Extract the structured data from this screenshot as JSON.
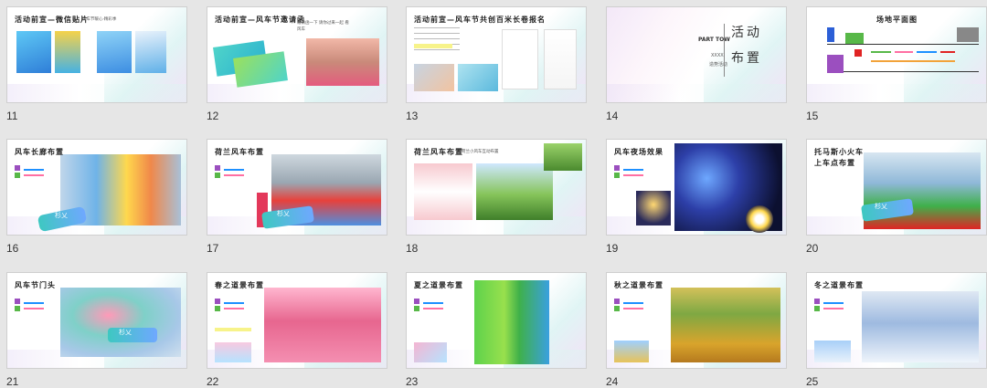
{
  "slides": [
    {
      "num": "11",
      "title": "活动前宣—微信贴片",
      "note": "风车节暖心·精彩季"
    },
    {
      "num": "12",
      "title": "活动前宣—风车节邀请函",
      "note": "邀请函一下 请你过来一起 看风车"
    },
    {
      "num": "13",
      "title": "活动前宣—风车节共创百米长卷报名",
      "note": "报名现场"
    },
    {
      "num": "14",
      "part": "PART TOW",
      "big1": "活动",
      "big2": "布置",
      "small": "XXXX",
      "sub": "造势活动"
    },
    {
      "num": "15",
      "title": "场地平面图"
    },
    {
      "num": "16",
      "title": "风车长廊布置",
      "banner": "杉乂"
    },
    {
      "num": "17",
      "title": "荷兰风车布置",
      "banner": "杉乂"
    },
    {
      "num": "18",
      "title": "荷兰风车布置",
      "note": "荷兰小风车互动布置"
    },
    {
      "num": "19",
      "title": "风车夜场效果"
    },
    {
      "num": "20",
      "title": "托马斯小火车",
      "title2": "上车点布置",
      "banner": "杉乂"
    },
    {
      "num": "21",
      "title": "风车节门头",
      "banner": "杉乂"
    },
    {
      "num": "22",
      "title": "春之道景布置"
    },
    {
      "num": "23",
      "title": "夏之道景布置"
    },
    {
      "num": "24",
      "title": "秋之道景布置"
    },
    {
      "num": "25",
      "title": "冬之道景布置"
    }
  ],
  "colors": {
    "background": "#e6e6e6",
    "accent_pink": "#ff6fa3",
    "accent_teal": "#3ec8c1",
    "accent_purple": "#8b5cf6"
  }
}
